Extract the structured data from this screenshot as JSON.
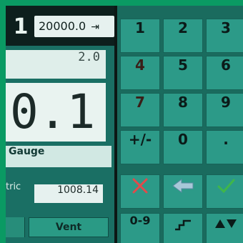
{
  "header": {
    "screen_number": "1",
    "setpoint": "20000.0"
  },
  "display": {
    "rate": "2.0",
    "main_value": "0.1",
    "mode": "Gauge",
    "baro_label": "tric",
    "baro_value": "1008.14",
    "vent_label": "Vent"
  },
  "keypad": {
    "digits": [
      "1",
      "2",
      "3",
      "4",
      "5",
      "6",
      "7",
      "8",
      "9"
    ],
    "sign": "+/-",
    "zero": "0",
    "decimal": ".",
    "range_label": "0-9"
  },
  "colors": {
    "frame_green": "#0a9a63",
    "panel": "#1a6f64",
    "key_face": "#2c9a88",
    "cancel_red": "#e14b4b",
    "accept_green": "#3fb64a"
  }
}
